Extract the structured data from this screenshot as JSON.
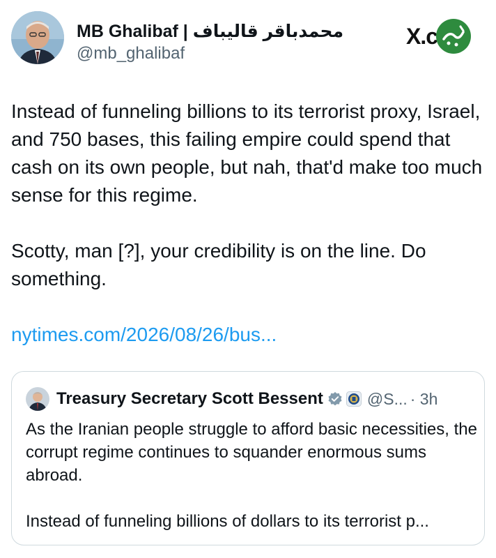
{
  "author": {
    "display_name": "MB Ghalibaf | محمدباقر قالیباف",
    "handle": "@mb_ghalibaf"
  },
  "source_label": "X.com",
  "tweet": {
    "paragraph_1": "Instead of funneling billions to its terrorist proxy, Israel, and 750 bases, this failing empire could spend that cash on its own people, but nah, that'd make too much sense for this regime.",
    "paragraph_2": "Scotty, man [?], your credibility is on the line. Do something.",
    "link": "nytimes.com/2026/08/26/bus..."
  },
  "quoted_tweet": {
    "display_name": "Treasury Secretary Scott Bessent",
    "handle": "@S...",
    "time": "· 3h",
    "paragraph_1": "As the Iranian people struggle to afford basic necessities, the corrupt regime continues to squander enormous sums abroad.",
    "paragraph_2": "Instead of funneling billions of dollars to its terrorist p..."
  },
  "icons": {
    "verified": "verified-badge-icon",
    "affiliation": "treasury-seal-icon",
    "watermark": "green-watermark-logo"
  },
  "colors": {
    "link": "#1d9bf0",
    "secondary_text": "#536471",
    "border": "#cfd9de",
    "watermark": "#2e8b3e"
  }
}
